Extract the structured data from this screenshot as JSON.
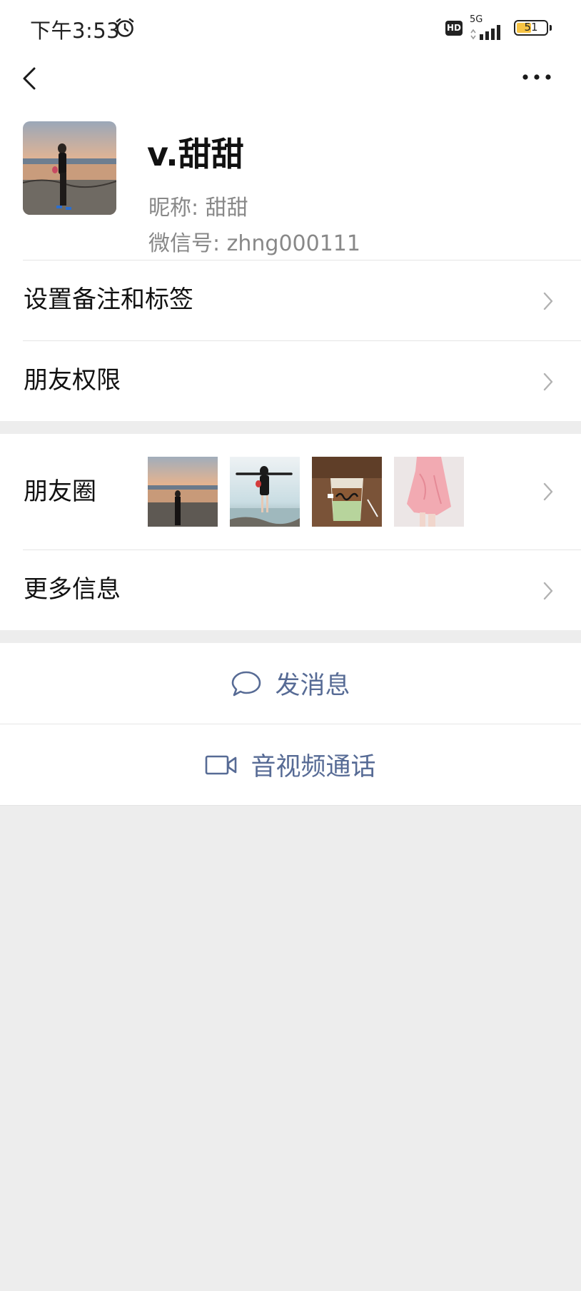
{
  "status_bar": {
    "time": "下午3:53",
    "hd": "HD",
    "network": "5G",
    "battery": "51",
    "battery_level": 0.51,
    "icons": [
      "alarm-icon",
      "signal-icon"
    ]
  },
  "nav": {
    "back_icon": "chevron-left-icon",
    "more_icon": "ellipsis-icon"
  },
  "profile": {
    "name": "v.甜甜",
    "nickname": "昵称:  甜甜",
    "wechat_id": "微信号:  zhng000111"
  },
  "rows": {
    "remark_tags": "设置备注和标签",
    "permissions": "朋友权限",
    "moments": "朋友圈",
    "more_info": "更多信息"
  },
  "moments_thumbs": [
    "sunset-photo",
    "beach-photo",
    "coffee-photo",
    "dress-photo"
  ],
  "actions": {
    "send_message": "发消息",
    "video_call": "音视频通话"
  },
  "colors": {
    "link": "#576b95",
    "background": "#ededed",
    "battery": "#f6c343"
  }
}
